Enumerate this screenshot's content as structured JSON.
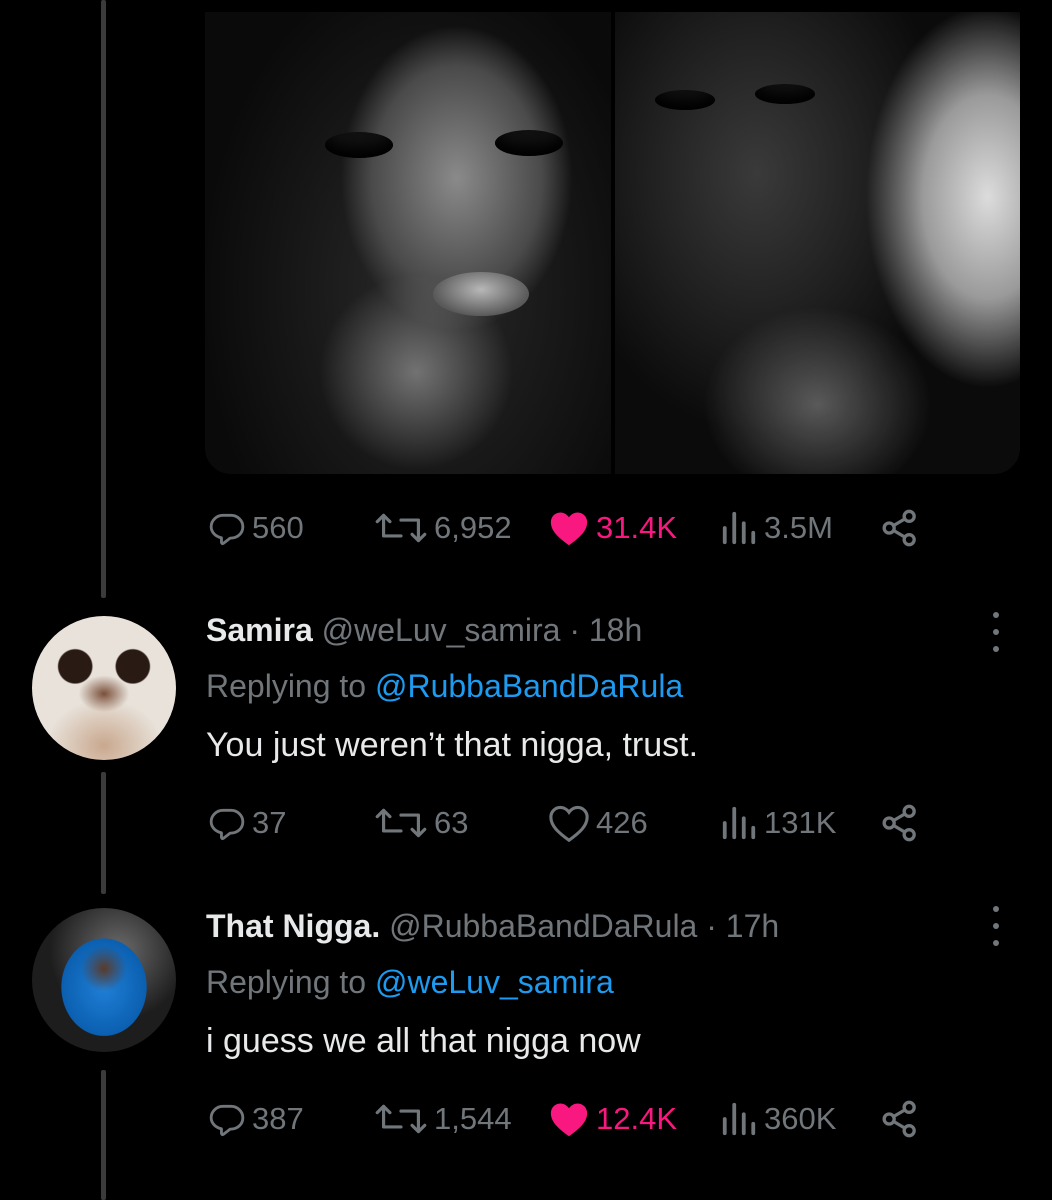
{
  "original_tweet": {
    "media": [
      "photo",
      "photo"
    ],
    "stats": {
      "replies": "560",
      "retweets": "6,952",
      "likes": "31.4K",
      "views": "3.5M"
    },
    "liked": true
  },
  "replies": [
    {
      "name": "Samira",
      "handle": "@weLuv_samira",
      "time": "18h",
      "replying_label": "Replying to",
      "replying_to": "@RubbaBandDaRula",
      "text": "You just weren’t that nigga, trust.",
      "stats": {
        "replies": "37",
        "retweets": "63",
        "likes": "426",
        "views": "131K"
      },
      "liked": false
    },
    {
      "name": "That Nigga.",
      "handle": "@RubbaBandDaRula",
      "time": "17h",
      "replying_label": "Replying to",
      "replying_to": "@weLuv_samira",
      "text": "i guess we all that nigga now",
      "stats": {
        "replies": "387",
        "retweets": "1,544",
        "likes": "12.4K",
        "views": "360K"
      },
      "liked": true
    }
  ],
  "icons": {
    "reply": "reply-icon",
    "retweet": "retweet-icon",
    "like": "heart-icon",
    "views": "views-icon",
    "share": "share-icon",
    "more": "more-icon"
  },
  "colors": {
    "background": "#000000",
    "text": "#e7e9ea",
    "muted": "#71767b",
    "link": "#1d9bf0",
    "like": "#f91880",
    "thread_line": "#3b3b3b"
  }
}
